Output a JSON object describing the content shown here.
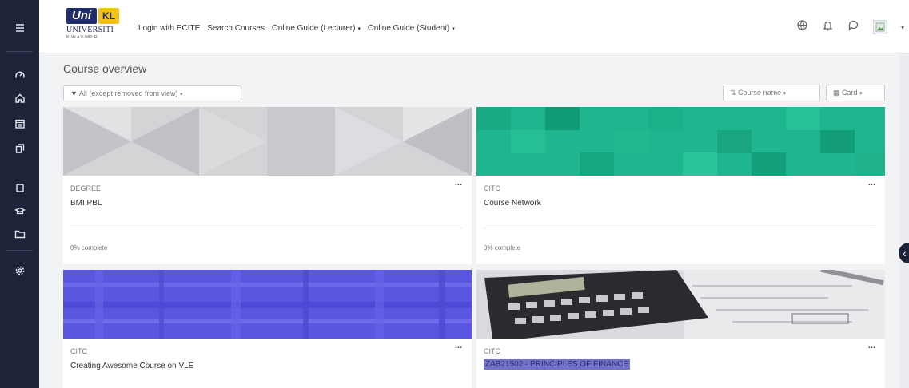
{
  "sidebar": {
    "items": [
      {
        "icon": "menu-icon",
        "label": "Menu"
      },
      {
        "icon": "dashboard-icon",
        "label": "Dashboard"
      },
      {
        "icon": "home-icon",
        "label": "Home"
      },
      {
        "icon": "calendar-icon",
        "label": "Calendar"
      },
      {
        "icon": "files-icon",
        "label": "Files"
      },
      {
        "icon": "content-bank-icon",
        "label": "Content bank"
      },
      {
        "icon": "courses-icon",
        "label": "Courses"
      },
      {
        "icon": "folder-icon",
        "label": "Folder"
      },
      {
        "icon": "settings-icon",
        "label": "Settings"
      }
    ]
  },
  "header": {
    "logo": {
      "uni": "Uni",
      "kl": "KL",
      "name": "UNIVERSITI",
      "sub": "KUALA LUMPUR"
    },
    "nav": [
      {
        "label": "Login with ECITE",
        "dropdown": false
      },
      {
        "label": "Search Courses",
        "dropdown": false
      },
      {
        "label": "Online Guide (Lecturer)",
        "dropdown": true
      },
      {
        "label": "Online Guide (Student)",
        "dropdown": true
      }
    ],
    "caret": "▾",
    "icons": [
      "language-icon",
      "notification-bell-icon",
      "messages-icon",
      "user-avatar-icon",
      "chevron-down-icon"
    ]
  },
  "overview": {
    "title": "Course overview",
    "filter_label": "All (except removed from view)",
    "sort_label": "Course name",
    "view_label": "Card"
  },
  "courses": [
    {
      "category": "DEGREE",
      "name": "BMI PBL",
      "progress": "0% complete",
      "menu": "...",
      "image": "gray-triangles"
    },
    {
      "category": "CITC",
      "name": "Course Network",
      "progress": "0% complete",
      "menu": "...",
      "image": "green-squares"
    },
    {
      "category": "CITC",
      "name": "Creating Awesome Course on VLE",
      "progress": "",
      "menu": "...",
      "image": "purple-plaid"
    },
    {
      "category": "CITC",
      "name": "ZAB21502 - PRINCIPLES OF FINANCE",
      "progress": "",
      "menu": "...",
      "image": "calculator-photo",
      "highlighted": true
    }
  ],
  "colors": {
    "sidebar_bg": "#1d2339",
    "accent_green": "#1fb58e",
    "accent_purple": "#5b56e0",
    "highlight": "#7171c9",
    "logo_blue": "#1f2d6b",
    "logo_yellow": "#f2c21b"
  }
}
